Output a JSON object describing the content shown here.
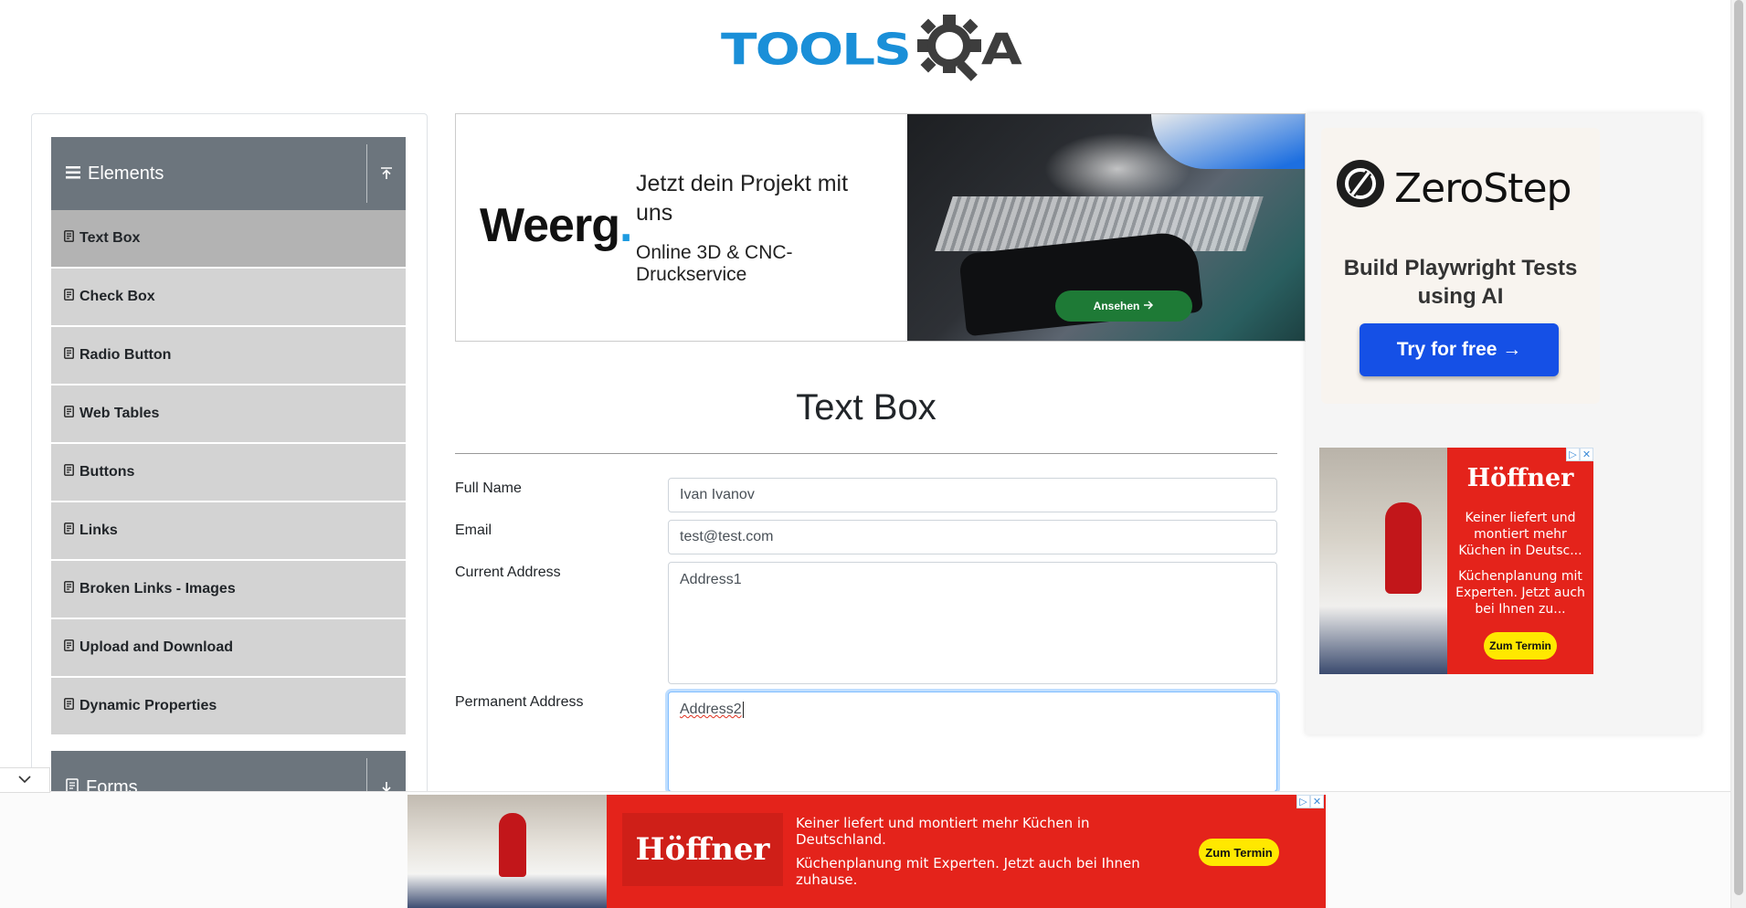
{
  "header": {
    "logo_tools": "TOOLS",
    "logo_a": "A"
  },
  "sidebar": {
    "elements_header": "Elements",
    "forms_header": "Forms",
    "items": [
      {
        "label": "Text Box",
        "active": true
      },
      {
        "label": "Check Box",
        "active": false
      },
      {
        "label": "Radio Button",
        "active": false
      },
      {
        "label": "Web Tables",
        "active": false
      },
      {
        "label": "Buttons",
        "active": false
      },
      {
        "label": "Links",
        "active": false
      },
      {
        "label": "Broken Links - Images",
        "active": false
      },
      {
        "label": "Upload and Download",
        "active": false
      },
      {
        "label": "Dynamic Properties",
        "active": false
      }
    ]
  },
  "ad_top": {
    "brand": "Weerg",
    "brand_dot": ".",
    "headline": "Jetzt dein Projekt mit uns",
    "subline": "Online 3D & CNC-Druckservice",
    "cta": "Ansehen"
  },
  "main": {
    "title": "Text Box",
    "fields": {
      "full_name": {
        "label": "Full Name",
        "value": "Ivan Ivanov"
      },
      "email": {
        "label": "Email",
        "value": "test@test.com"
      },
      "current_address": {
        "label": "Current Address",
        "value": "Address1"
      },
      "permanent_address": {
        "label": "Permanent Address",
        "value": "Address2"
      }
    }
  },
  "ad_right": {
    "zerostep_brand": "ZeroStep",
    "zerostep_sub": "Build Playwright Tests using AI",
    "zerostep_cta": "Try for free →",
    "hoffner_brand": "Höffner",
    "hoffner_line1": "Keiner liefert und montiert mehr Küchen in Deutsc...",
    "hoffner_line2": "Küchenplanung mit Experten. Jetzt auch bei Ihnen zu...",
    "hoffner_cta": "Zum Termin"
  },
  "ad_bottom": {
    "brand": "Höffner",
    "line1": "Keiner liefert und montiert mehr Küchen in Deutschland.",
    "line2": "Küchenplanung mit Experten. Jetzt auch bei Ihnen zuhause.",
    "cta": "Zum Termin"
  },
  "colors": {
    "accent_blue": "#1a8fd8",
    "menu_header": "#6c757d",
    "menu_item": "#d3d3d3",
    "ad_red": "#e4231b"
  },
  "icons": [
    "hamburger-icon",
    "upload-icon",
    "menu-item-icon",
    "chevron-down-icon",
    "arrow-right-icon",
    "ad-info-icon",
    "ad-close-icon",
    "zerostep-logo-icon",
    "gear-magnifier-icon"
  ]
}
